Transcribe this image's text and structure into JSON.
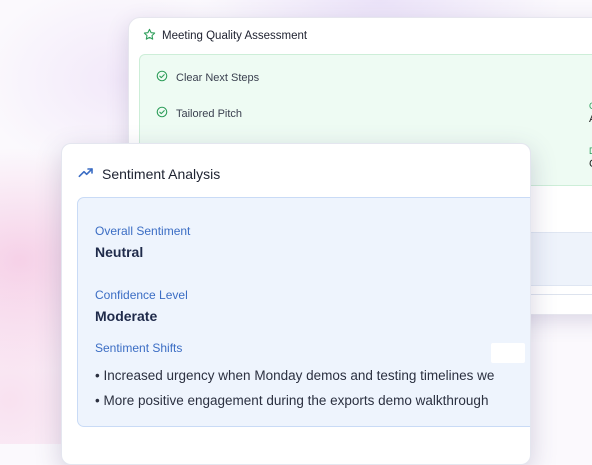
{
  "quality": {
    "title": "Meeting Quality Assessment",
    "checks": [
      {
        "label": "Clear Next Steps"
      },
      {
        "label": "Tailored Pitch"
      }
    ],
    "right_glyphs": [
      "C",
      "A",
      "D",
      "C"
    ]
  },
  "sentiment": {
    "title": "Sentiment Analysis",
    "overall_label": "Overall Sentiment",
    "overall_value": "Neutral",
    "confidence_label": "Confidence Level",
    "confidence_value": "Moderate",
    "shifts_label": "Sentiment Shifts",
    "shifts": [
      "• Increased urgency when Monday demos and testing timelines we",
      "• More positive engagement during the exports demo walkthrough"
    ]
  },
  "colors": {
    "green_accent": "#2f9e5b",
    "blue_accent": "#3b6dc4"
  }
}
